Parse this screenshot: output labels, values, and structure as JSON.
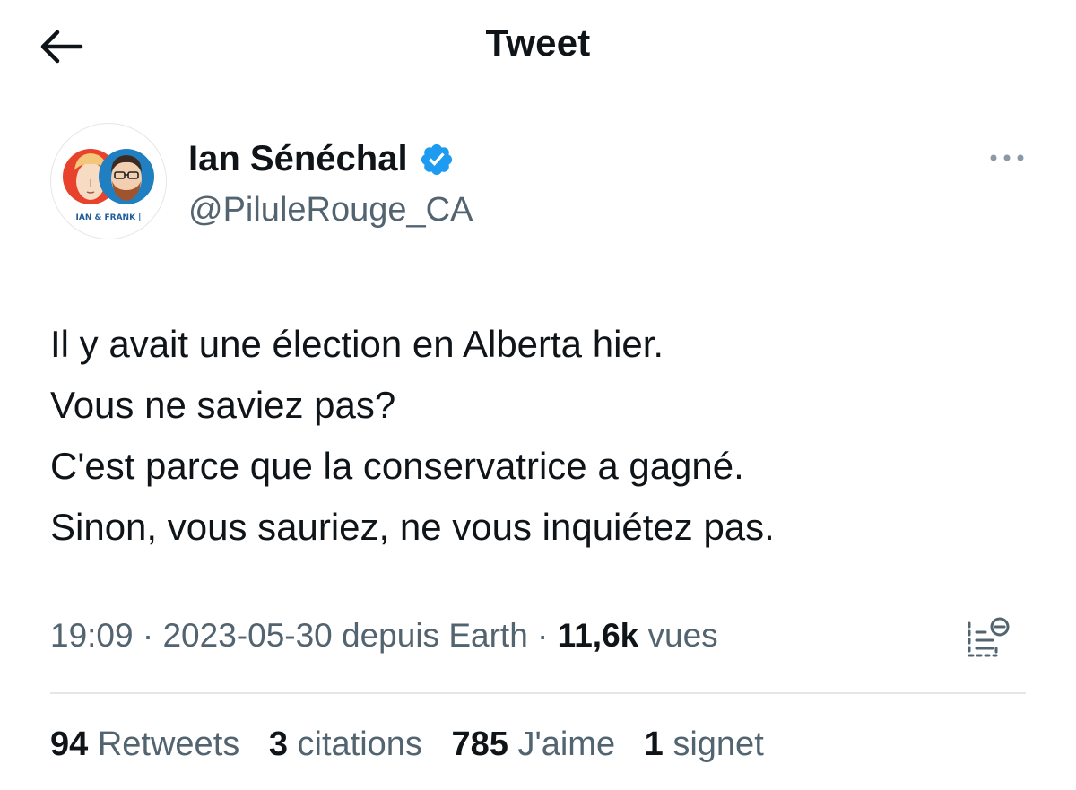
{
  "header": {
    "title": "Tweet",
    "back_icon": "arrow-left-icon"
  },
  "author": {
    "display_name": "Ian Sénéchal",
    "handle": "@PiluleRouge_CA",
    "verified_icon": "verified-badge-icon",
    "verified_color": "#1d9bf0",
    "avatar_caption": "IAN & FRANK |",
    "more_icon": "more-dots-icon"
  },
  "tweet": {
    "lines": [
      "Il y avait une élection en Alberta hier.",
      "Vous ne saviez pas?",
      "C'est parce que la conservatrice a gagné.",
      "Sinon, vous sauriez, ne vous inquiétez pas."
    ]
  },
  "meta": {
    "time": "19:09",
    "sep1": " · ",
    "date": "2023-05-30",
    "source": " depuis Earth",
    "sep2": " · ",
    "views_count": "11,6k",
    "views_label": " vues",
    "analytics_icon": "analytics-icon"
  },
  "stats": {
    "retweets_count": "94",
    "retweets_label": "Retweets",
    "quotes_count": "3",
    "quotes_label": "citations",
    "likes_count": "785",
    "likes_label": "J'aime",
    "bookmarks_count": "1",
    "bookmarks_label": "signet"
  },
  "colors": {
    "text": "#0f1419",
    "secondary": "#536471",
    "divider": "#e4e6ea"
  }
}
